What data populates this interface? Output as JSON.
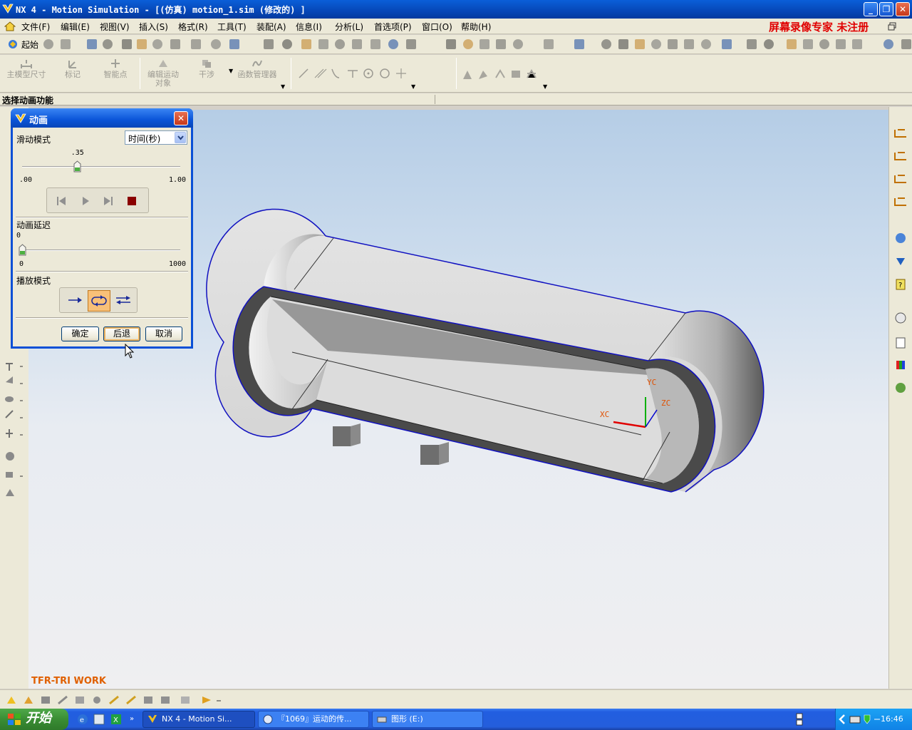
{
  "window": {
    "title": "NX 4 - Motion Simulation - [(仿真) motion_1.sim (修改的) ]",
    "caption_min": "_",
    "caption_max": "❐",
    "caption_close": "✕"
  },
  "menubar": {
    "items": [
      "文件(F)",
      "编辑(E)",
      "视图(V)",
      "插入(S)",
      "格式(R)",
      "工具(T)",
      "装配(A)",
      "信息(I)",
      "分析(L)",
      "首选项(P)",
      "窗口(O)",
      "帮助(H)"
    ],
    "watermark": "屏幕录像专家  未注册"
  },
  "toolbar1": {
    "start_label": "起始"
  },
  "toolbar2": {
    "tools": [
      {
        "label": "主模型尺寸",
        "icon": "dimension-icon"
      },
      {
        "label": "标记",
        "icon": "marker-icon"
      },
      {
        "label": "智能点",
        "icon": "smart-point-icon"
      },
      {
        "label": "编辑运动对象",
        "icon": "edit-motion-icon"
      },
      {
        "label": "干涉",
        "icon": "interference-icon"
      },
      {
        "label": "函数管理器",
        "icon": "function-manager-icon"
      }
    ]
  },
  "cue_line": {
    "text": "选择动画功能"
  },
  "viewport": {
    "label": "TFR-TRI WORK",
    "axis_x": "XC",
    "axis_y": "YC",
    "axis_z": "ZC",
    "colors": {
      "edge": "#1010c0",
      "axis_x": "#e00000",
      "axis_y": "#00b000",
      "axis_z": "#0000d0",
      "axis_label": "#e05000"
    }
  },
  "dialog": {
    "title": "动画",
    "close": "✕",
    "slide_mode_label": "滑动模式",
    "slide_mode_value": "时间(秒)",
    "slider": {
      "value": 0.35,
      "value_text": ".35",
      "min_text": ".00",
      "max_text": "1.00"
    },
    "delay_label": "动画延迟",
    "delay": {
      "value": 0,
      "value_text": "0",
      "min_text": "0",
      "max_text": "1000"
    },
    "play_mode_label": "播放模式",
    "play_mode_selected": "loop",
    "buttons": {
      "ok": "确定",
      "back": "后退",
      "cancel": "取消"
    }
  },
  "taskbar": {
    "start": "开始",
    "tasks": [
      "NX 4 - Motion Si...",
      "『1069』运动的传...",
      "图形  (E:)"
    ],
    "clock": "16:46"
  }
}
